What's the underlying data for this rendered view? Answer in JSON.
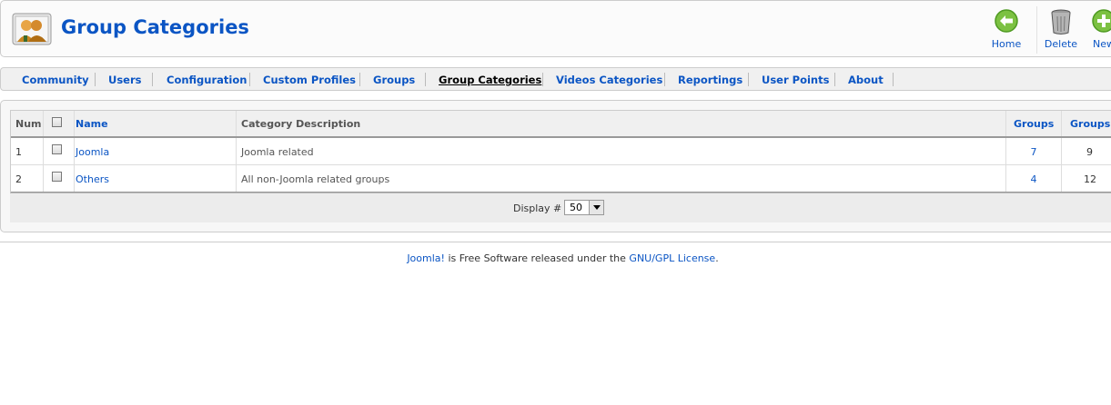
{
  "header": {
    "title": "Group Categories",
    "icon": "group-categories-icon"
  },
  "toolbar": {
    "home_label": "Home",
    "delete_label": "Delete",
    "new_label": "New"
  },
  "submenu": {
    "items": [
      {
        "label": "Community"
      },
      {
        "label": "Users"
      },
      {
        "label": "Configuration"
      },
      {
        "label": "Custom Profiles"
      },
      {
        "label": "Groups"
      },
      {
        "label": "Group Categories",
        "active": true
      },
      {
        "label": "Videos Categories"
      },
      {
        "label": "Reportings"
      },
      {
        "label": "User Points"
      },
      {
        "label": "About"
      }
    ]
  },
  "table": {
    "headers": {
      "num": "Num",
      "name": "Name",
      "description": "Category Description",
      "groups1": "Groups",
      "groups2": "Groups"
    },
    "rows": [
      {
        "num": "1",
        "name": "Joomla",
        "description": "Joomla related",
        "groups1": "7",
        "groups2": "9"
      },
      {
        "num": "2",
        "name": "Others",
        "description": "All non-Joomla related groups",
        "groups1": "4",
        "groups2": "12"
      }
    ]
  },
  "pagination": {
    "display_label": "Display #",
    "display_value": "50"
  },
  "footer": {
    "link1": "Joomla!",
    "text": " is Free Software released under the ",
    "link2": "GNU/GPL License",
    "end": "."
  },
  "colors": {
    "link": "#0b55c4",
    "home_icon": "#7cc142"
  }
}
